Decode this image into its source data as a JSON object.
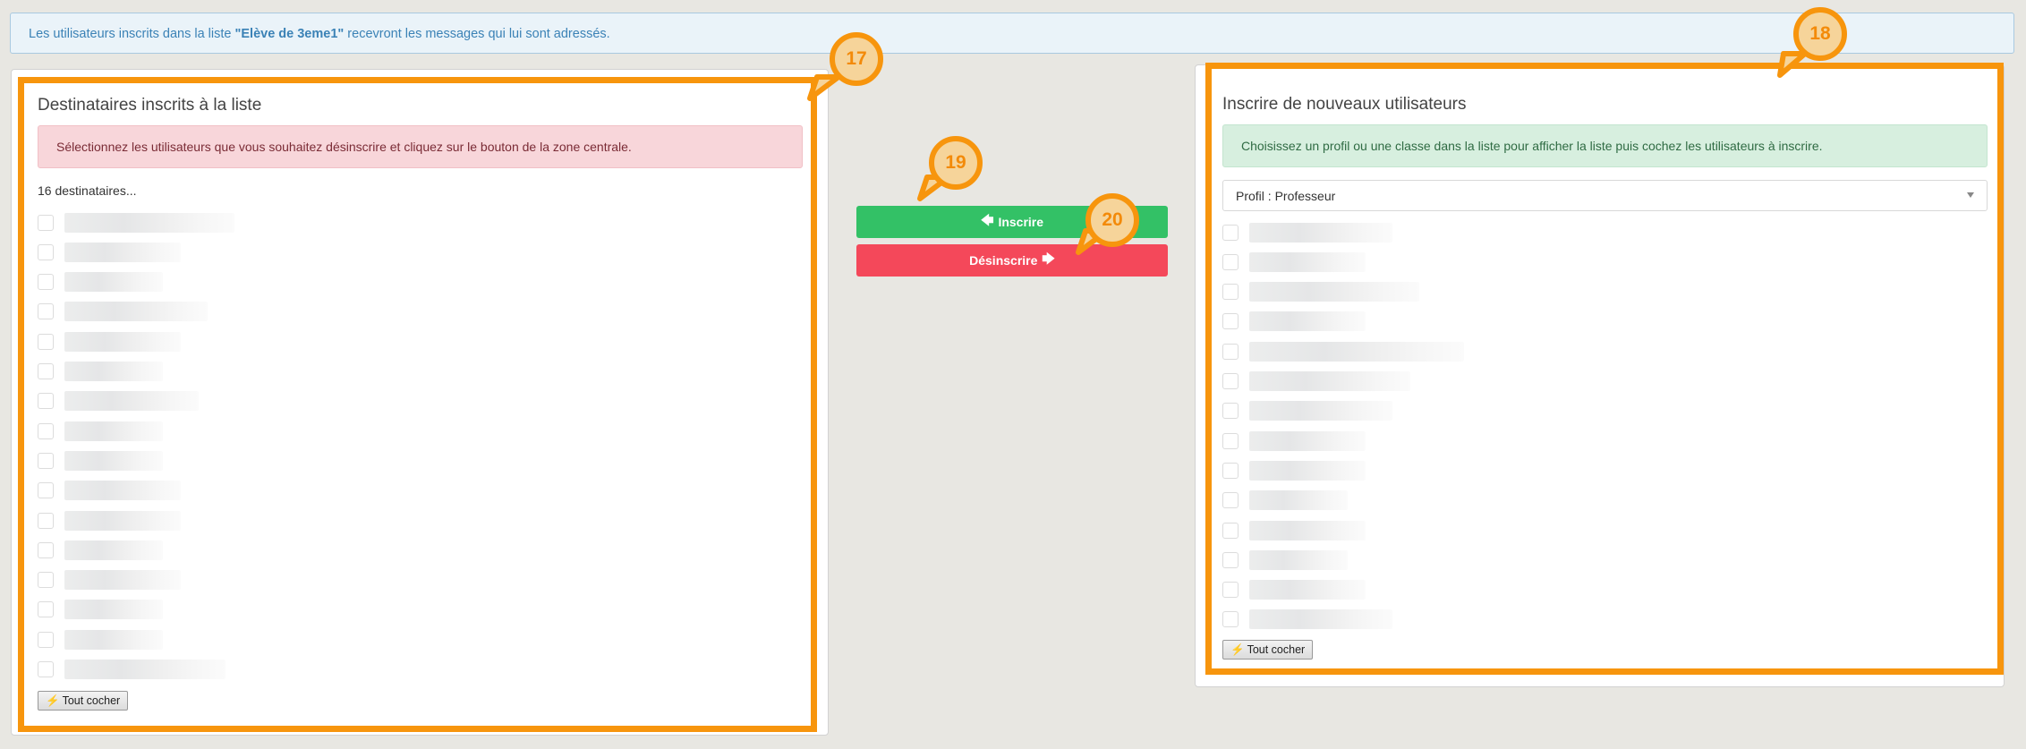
{
  "info": {
    "prefix": "Les utilisateurs inscrits dans la liste ",
    "list_name": "\"Elève de 3eme1\"",
    "suffix": " recevront les messages qui lui sont adressés."
  },
  "left_panel": {
    "title": "Destinataires inscrits à la liste",
    "alert": "Sélectionnez les utilisateurs que vous souhaitez désinscrire et cliquez sur le bouton de la zone centrale.",
    "count": "16 destinataires...",
    "check_all": "Tout cocher",
    "row_count": 16
  },
  "right_panel": {
    "title": "Inscrire de nouveaux utilisateurs",
    "alert": "Choisissez un profil ou une classe dans la liste pour afficher la liste puis cochez les utilisateurs à inscrire.",
    "select_value": "Profil : Professeur",
    "check_all": "Tout cocher",
    "row_count": 14
  },
  "actions": {
    "inscrire": "Inscrire",
    "desinscrire": "Désinscrire"
  },
  "callouts": {
    "left": "17",
    "right": "18",
    "inscrire": "19",
    "desinscrire": "20"
  },
  "colors": {
    "highlight": "#f7950d",
    "green": "#33c166",
    "red": "#f4485a"
  }
}
